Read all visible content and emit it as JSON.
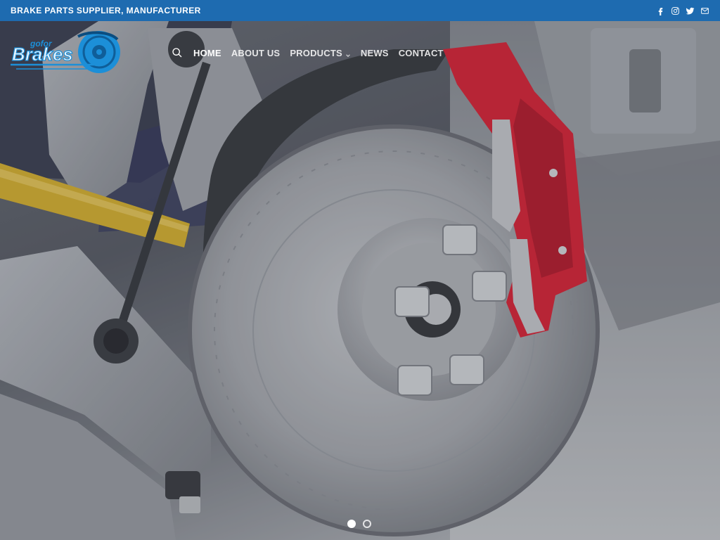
{
  "topbar": {
    "tagline": "BRAKE PARTS SUPPLIER, MANUFACTURER",
    "social": [
      "facebook-icon",
      "instagram-icon",
      "twitter-icon",
      "email-icon"
    ]
  },
  "header": {
    "logo_text_top": "gofor",
    "logo_text_main": "Brakes",
    "nav": [
      {
        "label": "HOME",
        "active": true
      },
      {
        "label": "ABOUT US",
        "active": false
      },
      {
        "label": "PRODUCTS",
        "active": false,
        "has_dropdown": true
      },
      {
        "label": "NEWS",
        "active": false
      },
      {
        "label": "CONTACT",
        "active": false
      }
    ]
  },
  "hero": {
    "subject": "brake-disc-and-caliper-image",
    "slides_count": 2,
    "active_slide": 1
  },
  "colors": {
    "topbar": "#1e6bb0",
    "caliper": "#d9273a",
    "logo_blue": "#1c8fd8"
  }
}
